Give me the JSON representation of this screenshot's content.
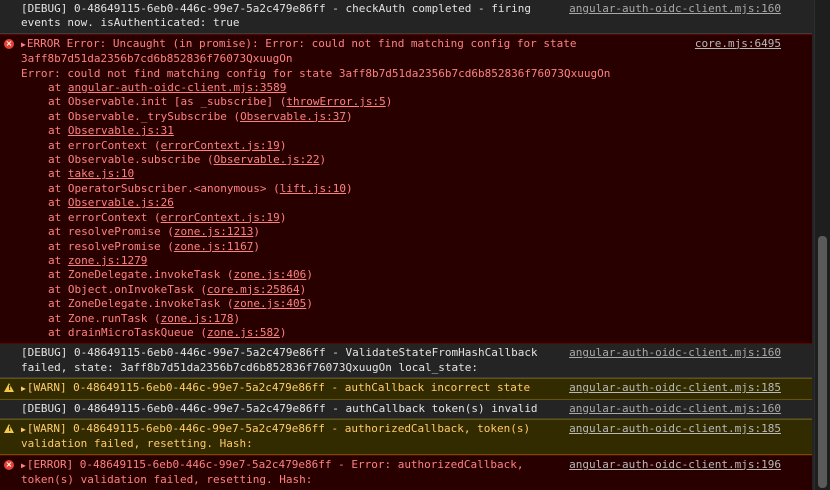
{
  "messages": [
    {
      "type": "debug",
      "lines": [
        "[DEBUG] 0-48649115-6eb0-446c-99e7-5a2c479e86ff - checkAuth completed - firing",
        "events now. isAuthenticated: true"
      ],
      "source": "angular-auth-oidc-client.mjs:160"
    },
    {
      "type": "error",
      "lines": [
        "ERROR Error: Uncaught (in promise): Error: could not find matching config for state",
        "3aff8b7d51da2356b7cd6b852836f76073QxuugOn"
      ],
      "error_line": "Error: could not find matching config for state 3aff8b7d51da2356b7cd6b852836f76073QxuugOn",
      "source": "core.mjs:6495",
      "frames": [
        {
          "pre": "at ",
          "fn": "",
          "link": "angular-auth-oidc-client.mjs:3589"
        },
        {
          "pre": "at ",
          "fn": "Observable.init [as _subscribe] (",
          "link": "throwError.js:5"
        },
        {
          "pre": "at ",
          "fn": "Observable._trySubscribe (",
          "link": "Observable.js:37"
        },
        {
          "pre": "at ",
          "fn": "",
          "link": "Observable.js:31"
        },
        {
          "pre": "at ",
          "fn": "errorContext (",
          "link": "errorContext.js:19"
        },
        {
          "pre": "at ",
          "fn": "Observable.subscribe (",
          "link": "Observable.js:22"
        },
        {
          "pre": "at ",
          "fn": "",
          "link": "take.js:10"
        },
        {
          "pre": "at ",
          "fn": "OperatorSubscriber.<anonymous> (",
          "link": "lift.js:10"
        },
        {
          "pre": "at ",
          "fn": "",
          "link": "Observable.js:26"
        },
        {
          "pre": "at ",
          "fn": "errorContext (",
          "link": "errorContext.js:19"
        },
        {
          "pre": "at ",
          "fn": "resolvePromise (",
          "link": "zone.js:1213"
        },
        {
          "pre": "at ",
          "fn": "resolvePromise (",
          "link": "zone.js:1167"
        },
        {
          "pre": "at ",
          "fn": "",
          "link": "zone.js:1279"
        },
        {
          "pre": "at ",
          "fn": "ZoneDelegate.invokeTask (",
          "link": "zone.js:406"
        },
        {
          "pre": "at ",
          "fn": "Object.onInvokeTask (",
          "link": "core.mjs:25864"
        },
        {
          "pre": "at ",
          "fn": "ZoneDelegate.invokeTask (",
          "link": "zone.js:405"
        },
        {
          "pre": "at ",
          "fn": "Zone.runTask (",
          "link": "zone.js:178"
        },
        {
          "pre": "at ",
          "fn": "drainMicroTaskQueue (",
          "link": "zone.js:582"
        }
      ]
    },
    {
      "type": "debug",
      "lines": [
        "[DEBUG] 0-48649115-6eb0-446c-99e7-5a2c479e86ff - ValidateStateFromHashCallback",
        "failed, state: 3aff8b7d51da2356b7cd6b852836f76073QxuugOn local_state:"
      ],
      "source": "angular-auth-oidc-client.mjs:160"
    },
    {
      "type": "warn",
      "lines": [
        "[WARN] 0-48649115-6eb0-446c-99e7-5a2c479e86ff - authCallback incorrect state"
      ],
      "source": "angular-auth-oidc-client.mjs:185"
    },
    {
      "type": "debug",
      "lines": [
        "[DEBUG] 0-48649115-6eb0-446c-99e7-5a2c479e86ff - authCallback token(s) invalid"
      ],
      "source": "angular-auth-oidc-client.mjs:160"
    },
    {
      "type": "warn",
      "lines": [
        "[WARN] 0-48649115-6eb0-446c-99e7-5a2c479e86ff - authorizedCallback, token(s)",
        "validation failed, resetting. Hash:"
      ],
      "source": "angular-auth-oidc-client.mjs:185"
    },
    {
      "type": "error",
      "lines": [
        "[ERROR] 0-48649115-6eb0-446c-99e7-5a2c479e86ff - Error: authorizedCallback,",
        "token(s) validation failed, resetting. Hash:"
      ],
      "source": "angular-auth-oidc-client.mjs:196"
    }
  ],
  "icons": {
    "error": "error-circle-icon",
    "warn": "warning-triangle-icon",
    "expand": "expand-triangle-icon"
  },
  "colors": {
    "error_bg": "#290000",
    "warn_bg": "#332b00",
    "error_text": "#ff8080",
    "warn_text": "#ffcb6b"
  }
}
